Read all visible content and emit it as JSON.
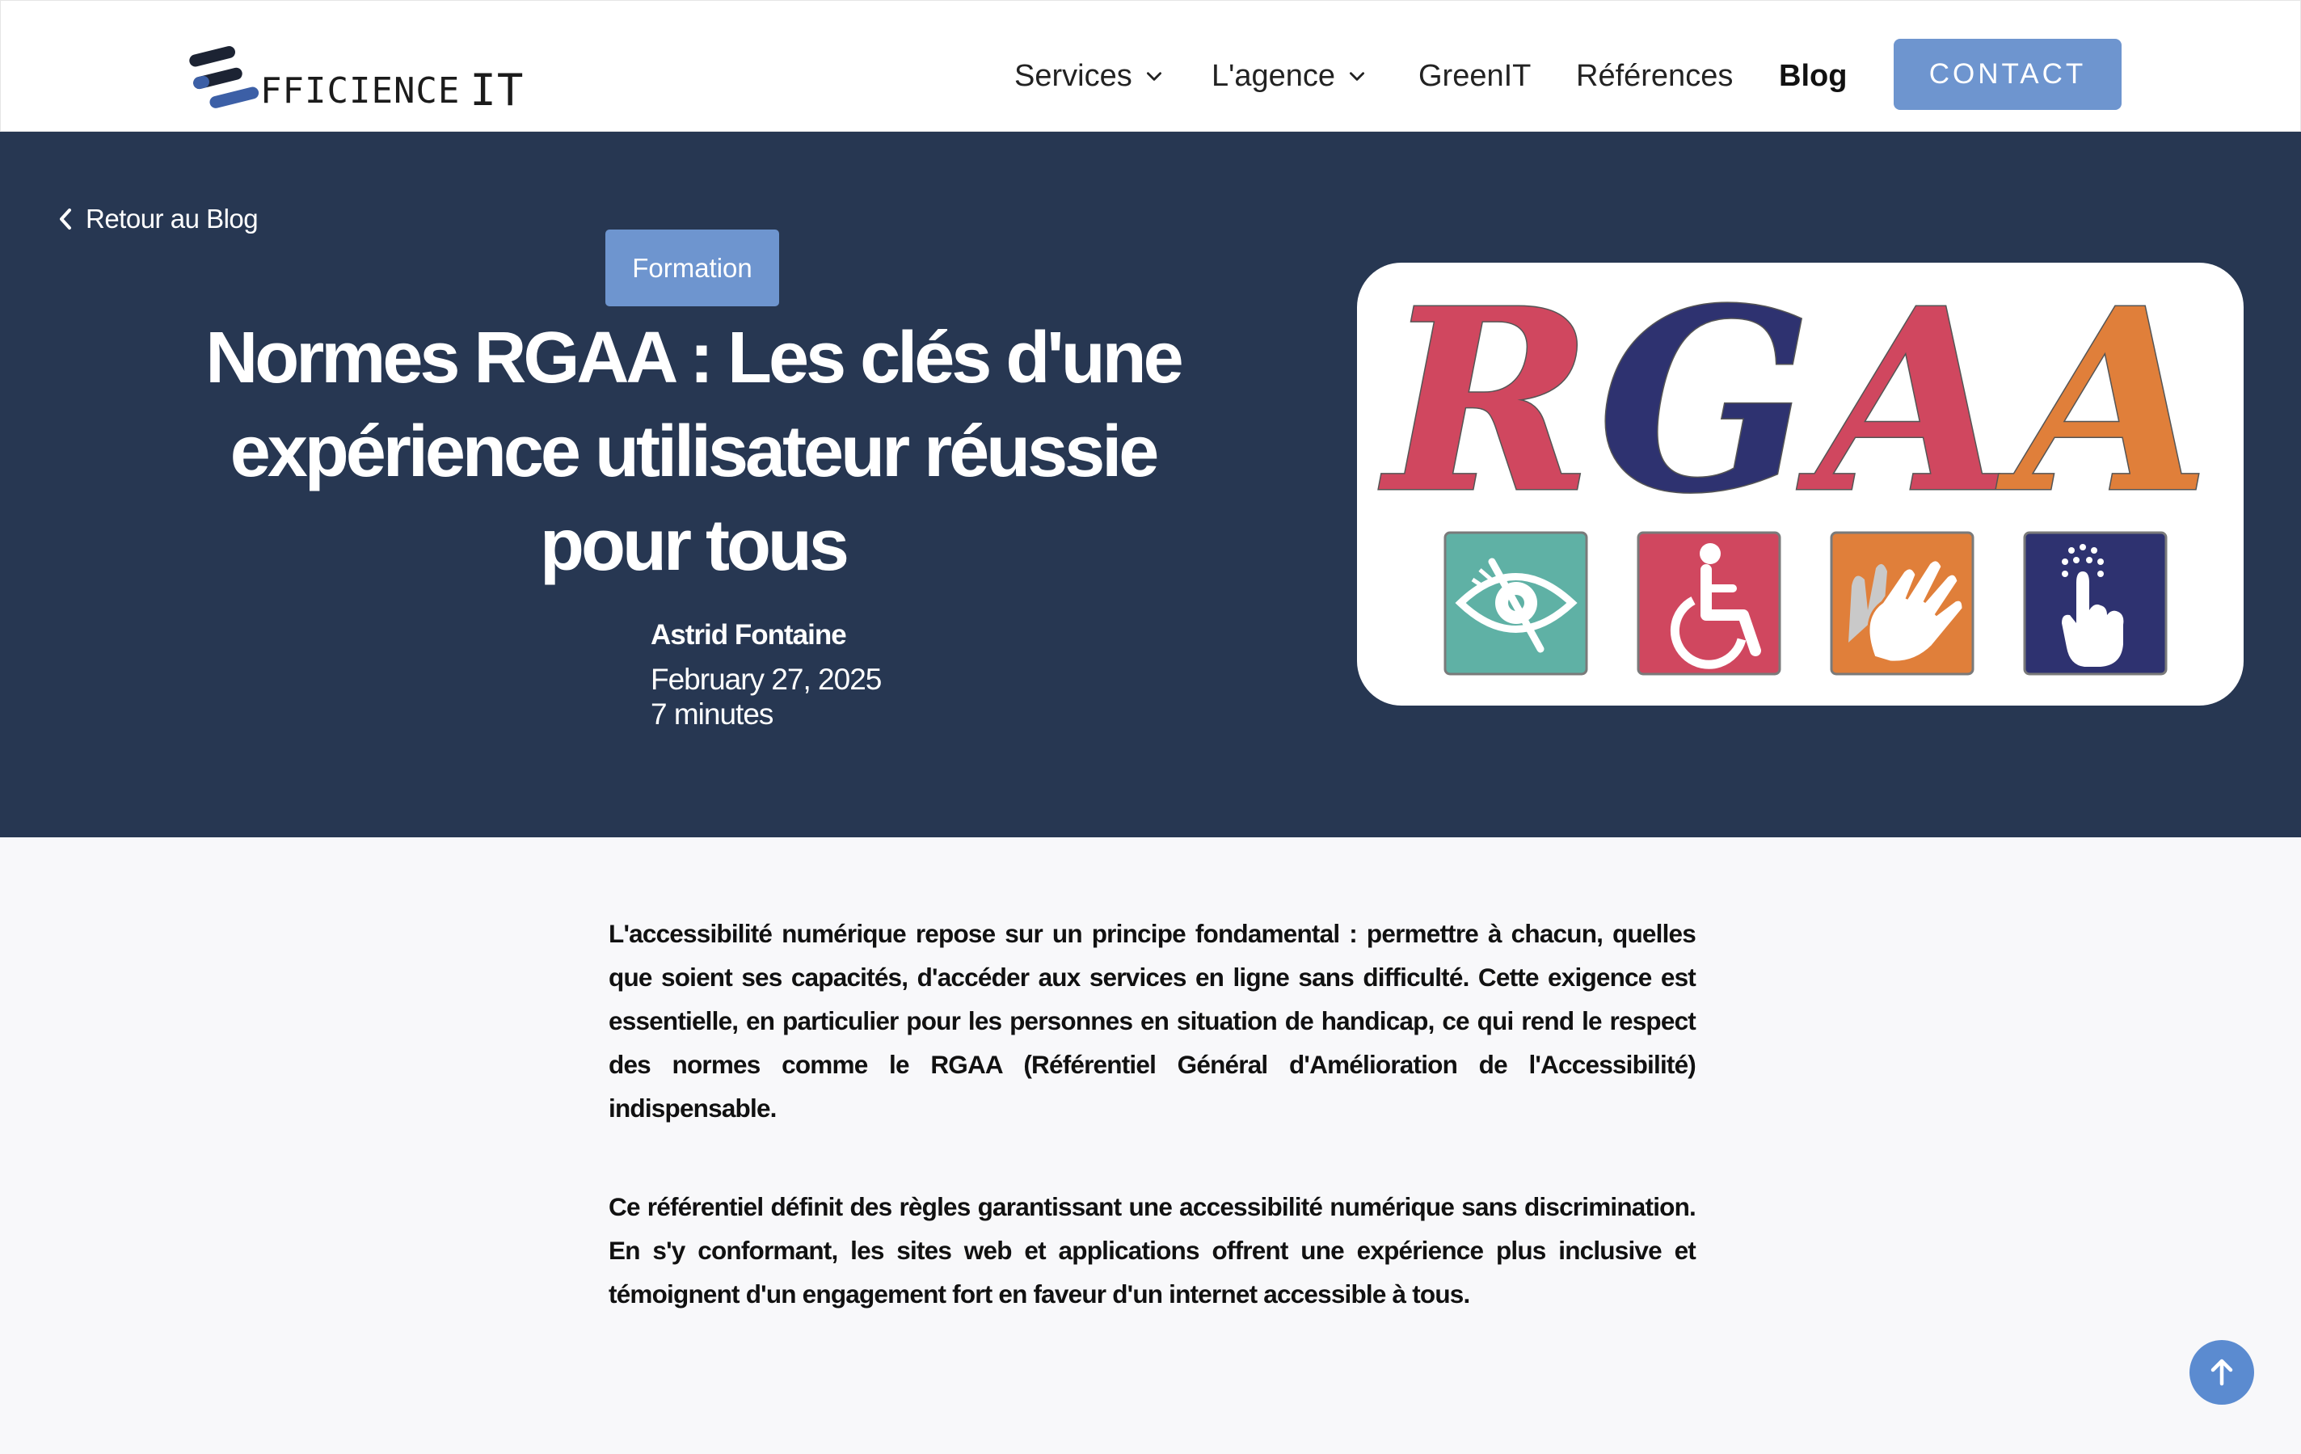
{
  "brand": {
    "logo_text": "FFICIENCE",
    "logo_suffix": "IT"
  },
  "nav": {
    "services": "Services",
    "agence": "L'agence",
    "greenit": "GreenIT",
    "references": "Références",
    "blog": "Blog",
    "contact": "CONTACT"
  },
  "hero": {
    "back_label": "Retour au Blog",
    "category": "Formation",
    "title": "Normes RGAA : Les clés d'une expérience utilisateur réussie pour tous",
    "author": "Astrid Fontaine",
    "date": "February 27, 2025",
    "read_time": "7 minutes",
    "image_text": "RGAA",
    "image_letter_colors": [
      "#d0475f",
      "#2e3270",
      "#d0475f",
      "#e07f3a"
    ],
    "image_tiles": [
      {
        "icon": "eye-slash-icon",
        "color": "#5fb1a5"
      },
      {
        "icon": "wheelchair-icon",
        "color": "#d0475f"
      },
      {
        "icon": "sign-language-hands-icon",
        "color": "#e07f3a"
      },
      {
        "icon": "braille-touch-icon",
        "color": "#2e3270"
      }
    ]
  },
  "article": {
    "paragraphs": [
      "L'accessibilité numérique repose sur un principe fondamental : permettre à chacun, quelles que soient ses capacités, d'accéder aux services en ligne sans difficulté. Cette exigence est essentielle, en particulier pour les personnes en situation de handicap, ce qui rend le respect des normes comme le RGAA (Référentiel Général d'Amélioration de l'Accessibilité) indispensable.",
      "Ce référentiel définit des règles garantissant une accessibilité numérique sans discrimination. En s'y conformant, les sites web et applications offrent une expérience plus inclusive et témoignent d'un engagement fort en faveur d'un internet accessible à tous."
    ]
  },
  "colors": {
    "accent": "#6e95cf",
    "hero_bg": "#273752",
    "page_bg": "#f8f8fa"
  }
}
